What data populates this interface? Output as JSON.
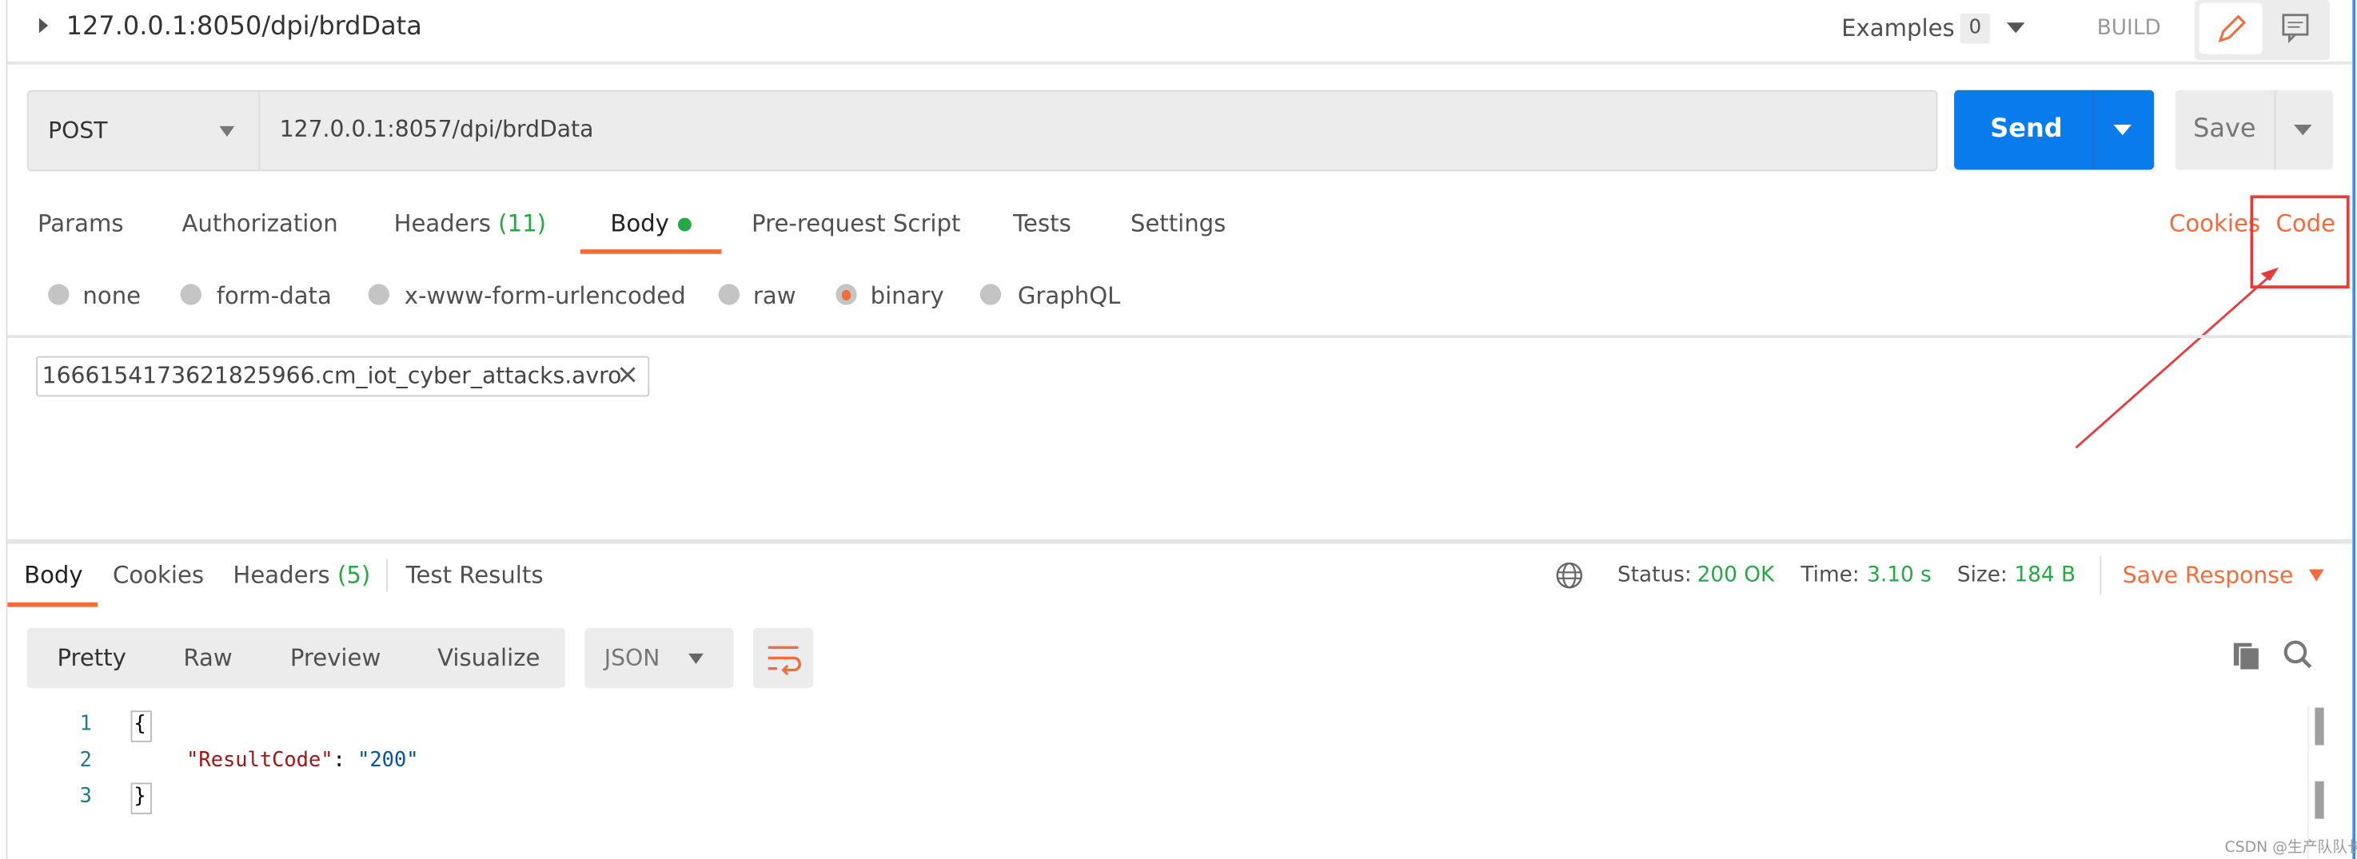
{
  "header": {
    "title": "127.0.0.1:8050/dpi/brdData",
    "examples_label": "Examples",
    "examples_count": "0",
    "build_label": "BUILD"
  },
  "request": {
    "method": "POST",
    "url": "127.0.0.1:8057/dpi/brdData",
    "send_label": "Send",
    "save_label": "Save"
  },
  "request_tabs": [
    {
      "label": "Params"
    },
    {
      "label": "Authorization"
    },
    {
      "label": "Headers",
      "count": "(11)"
    },
    {
      "label": "Body",
      "active": true
    },
    {
      "label": "Pre-request Script"
    },
    {
      "label": "Tests"
    },
    {
      "label": "Settings"
    }
  ],
  "links": {
    "cookies": "Cookies",
    "code": "Code"
  },
  "body_types": [
    {
      "label": "none"
    },
    {
      "label": "form-data"
    },
    {
      "label": "x-www-form-urlencoded"
    },
    {
      "label": "raw"
    },
    {
      "label": "binary",
      "selected": true
    },
    {
      "label": "GraphQL"
    }
  ],
  "file": {
    "name": "1666154173621825966.cm_iot_cyber_attacks.avro"
  },
  "response_tabs": [
    {
      "label": "Body",
      "active": true
    },
    {
      "label": "Cookies"
    },
    {
      "label": "Headers",
      "count": "(5)"
    },
    {
      "label": "Test Results"
    }
  ],
  "response_meta": {
    "status_label": "Status:",
    "status": "200 OK",
    "time_label": "Time:",
    "time": "3.10 s",
    "size_label": "Size:",
    "size": "184 B",
    "save_response": "Save Response"
  },
  "view_modes": [
    {
      "label": "Pretty",
      "active": true
    },
    {
      "label": "Raw"
    },
    {
      "label": "Preview"
    },
    {
      "label": "Visualize"
    }
  ],
  "format": "JSON",
  "code_lines": [
    {
      "num": "1",
      "text": "{"
    },
    {
      "num": "2",
      "key": "\"ResultCode\"",
      "sep": ": ",
      "value": "\"200\""
    },
    {
      "num": "3",
      "text": "}"
    }
  ],
  "watermark": "CSDN @生产队队长",
  "colors": {
    "accent": "#f26b3a",
    "send": "#097bed",
    "success": "#26a844",
    "annotation": "#e83a3a"
  }
}
